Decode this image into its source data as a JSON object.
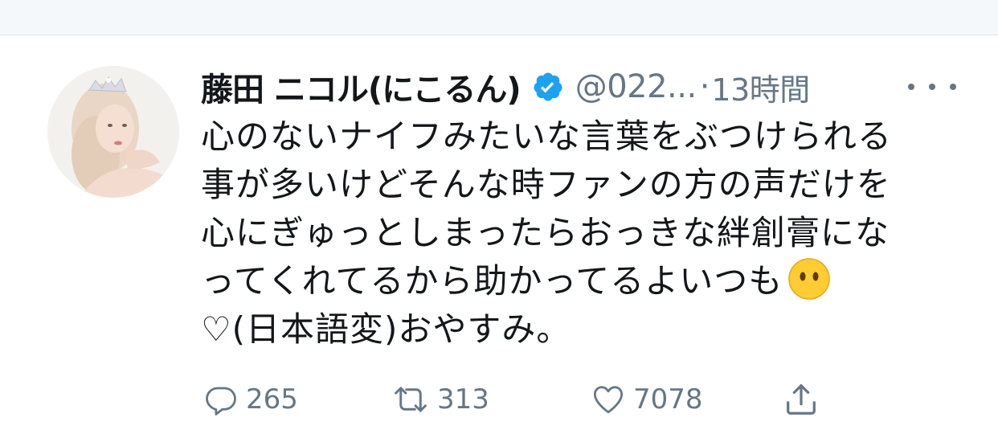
{
  "tweet": {
    "display_name": "藤田 ニコル(にこるん)",
    "handle": "@022...",
    "separator": "·",
    "time": "13時間",
    "body_lines": [
      "心のないナイフみたいな言葉をぶつけられる",
      "事が多いけどそんな時ファンの方の声だけを",
      "心にぎゅっとしまったらおっきな絆創膏にな",
      "ってくれてるから助かってるよいつも",
      "♡(日本語変)おやすみ。"
    ]
  },
  "actions": {
    "reply_count": "265",
    "retweet_count": "313",
    "like_count": "7078"
  },
  "icons": {
    "verified": "verified-badge-icon",
    "more": "more-options-icon",
    "reply": "reply-icon",
    "retweet": "retweet-icon",
    "like": "heart-icon",
    "share": "share-icon",
    "emoji": "face-without-mouth-emoji"
  },
  "colors": {
    "verified_blue": "#1da1f2",
    "secondary_text": "#657786",
    "primary_text": "#14171a",
    "emoji_yellow": "#ffcc33"
  }
}
